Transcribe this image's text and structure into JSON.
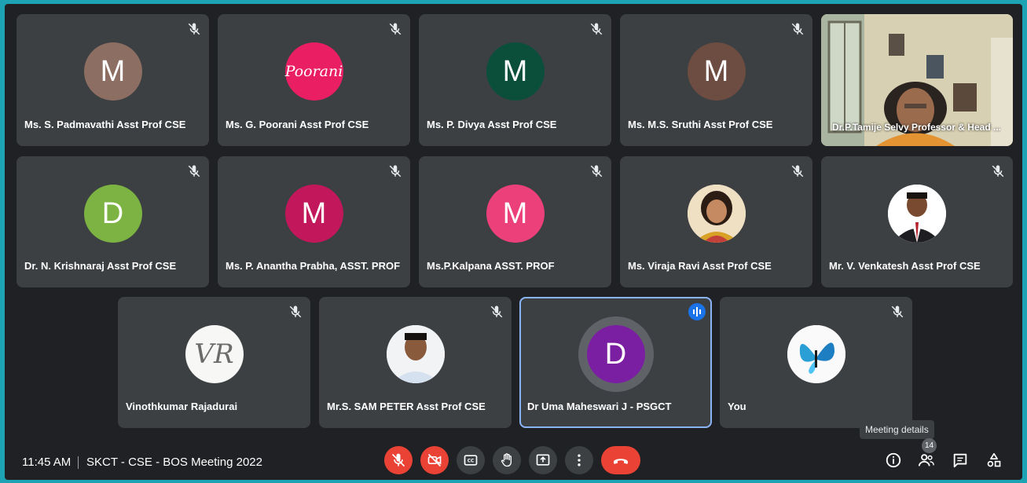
{
  "participants": [
    {
      "name": "Ms. S. Padmavathi Asst Prof CSE",
      "initial": "M",
      "color": "#8d6e63"
    },
    {
      "name": "Ms. G. Poorani Asst Prof CSE",
      "avatar_text": "Poorani",
      "color": "#e91e63"
    },
    {
      "name": "Ms. P. Divya Asst Prof CSE",
      "initial": "M",
      "color": "#0b4f3a"
    },
    {
      "name": "Ms. M.S. Sruthi Asst Prof CSE",
      "initial": "M",
      "color": "#6d4c41"
    },
    {
      "name": "Dr.P.Tamije Selvy Professor & Head ..."
    },
    {
      "name": "Dr. N. Krishnaraj Asst Prof CSE",
      "initial": "D",
      "color": "#7cb342"
    },
    {
      "name": "Ms. P. Anantha Prabha, ASST. PROF",
      "initial": "M",
      "color": "#c2185b"
    },
    {
      "name": "Ms.P.Kalpana ASST. PROF",
      "initial": "M",
      "color": "#ec407a"
    },
    {
      "name": "Ms. Viraja Ravi Asst Prof CSE"
    },
    {
      "name": "Mr. V. Venkatesh Asst Prof CSE"
    },
    {
      "name": "Vinothkumar Rajadurai",
      "avatar_text": "VR"
    },
    {
      "name": "Mr.S. SAM PETER Asst Prof CSE"
    },
    {
      "name": "Dr Uma Maheswari J - PSGCT",
      "initial": "D",
      "color": "#7b1fa2"
    },
    {
      "name": "You"
    }
  ],
  "tooltip": "Meeting details",
  "bottom": {
    "time": "11:45 AM",
    "meeting_name": "SKCT - CSE - BOS Meeting 2022",
    "people_count": "14"
  },
  "colors": {
    "background": "#202124",
    "tile": "#3c4043",
    "danger": "#ea4335",
    "accent": "#1a73e8"
  }
}
